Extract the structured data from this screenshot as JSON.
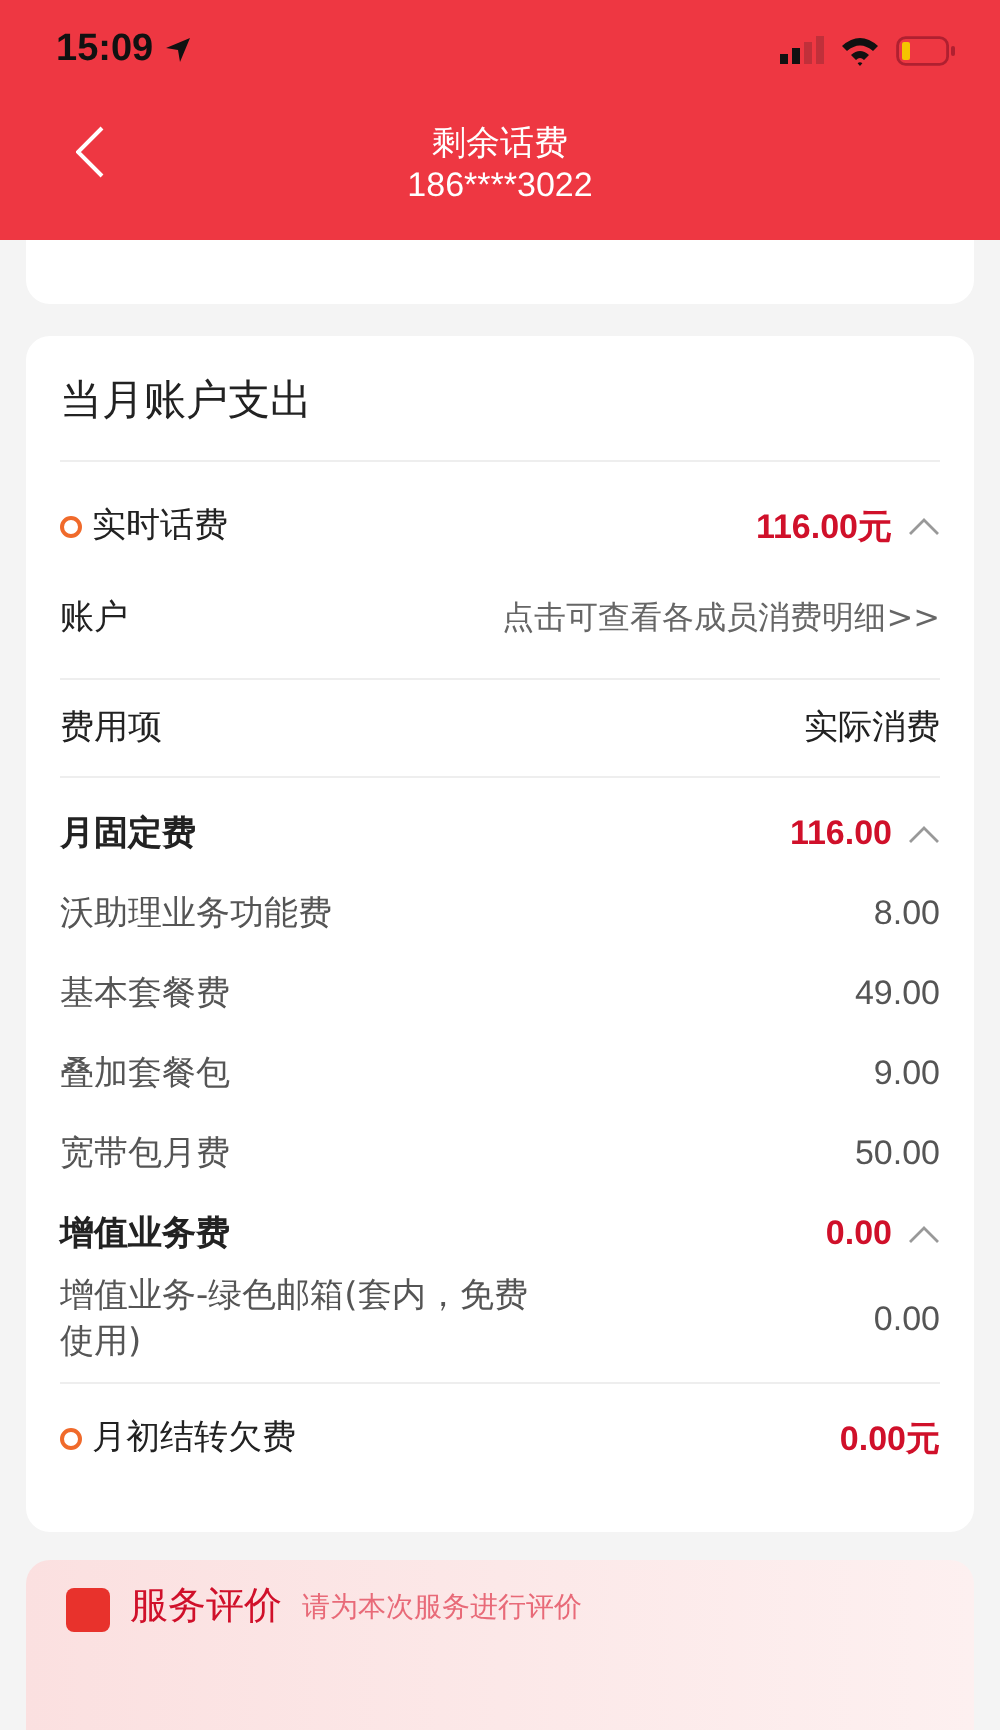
{
  "status_bar": {
    "time": "15:09"
  },
  "nav": {
    "title": "剩余话费",
    "subtitle": "186****3022"
  },
  "card": {
    "title": "当月账户支出",
    "realtime": {
      "label": "实时话费",
      "amount": "116.00元",
      "expanded": true
    },
    "account": {
      "label": "账户",
      "link": "点击可查看各成员消费明细>>"
    },
    "columns": [
      "费用项",
      "实际消费"
    ],
    "groups": [
      {
        "name": "月固定费",
        "amount": "116.00",
        "expanded": true,
        "items": [
          {
            "name": "沃助理业务功能费",
            "amount": "8.00"
          },
          {
            "name": "基本套餐费",
            "amount": "49.00"
          },
          {
            "name": "叠加套餐包",
            "amount": "9.00"
          },
          {
            "name": "宽带包月费",
            "amount": "50.00"
          }
        ]
      },
      {
        "name": "增值业务费",
        "amount": "0.00",
        "expanded": true,
        "items": [
          {
            "name": "增值业务-绿色邮箱(套内，免费使用)",
            "amount": "0.00"
          }
        ]
      }
    ],
    "carryover": {
      "label": "月初结转欠费",
      "amount": "0.00元"
    }
  },
  "service": {
    "title": "服务评价",
    "hint": "请为本次服务进行评价"
  }
}
